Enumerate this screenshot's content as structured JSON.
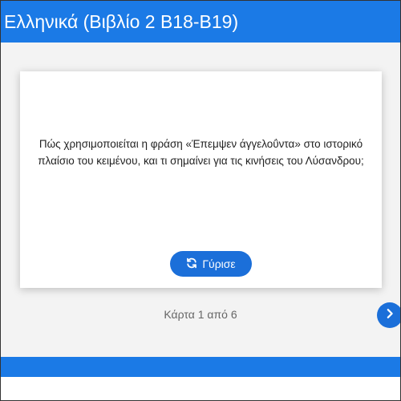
{
  "header": {
    "title": "Ελληνικά (Βιβλίο 2 Β18-Β19)"
  },
  "card": {
    "question": "Πώς χρησιμοποιείται η φράση «Έπεμψεν άγγελοΰντα» στο ιστορικό πλαίσιο του κειμένου, και τι σημαίνει για τις κινήσεις του Λύσανδρου;",
    "flip_label": "Γύρισε",
    "flip_icon": "refresh-icon"
  },
  "navigation": {
    "counter_text": "Κάρτα 1 από 6",
    "next_icon": "chevron-right-icon"
  },
  "colors": {
    "header": "#1b7ae6",
    "button": "#1b6fd9",
    "background": "#f3f3f3"
  }
}
